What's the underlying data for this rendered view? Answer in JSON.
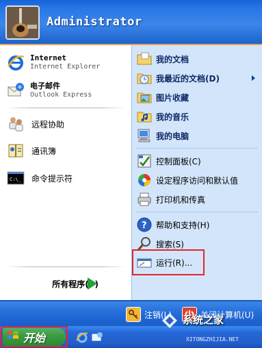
{
  "header": {
    "username": "Administrator",
    "avatar_icon": "guitar-avatar-icon"
  },
  "left": {
    "pinned": [
      {
        "title": "Internet",
        "subtitle": "Internet Explorer",
        "icon": "internet-explorer-icon"
      },
      {
        "title": "电子邮件",
        "subtitle": "Outlook Express",
        "icon": "outlook-express-icon"
      }
    ],
    "recent": [
      {
        "label": "远程协助",
        "icon": "remote-assistance-icon"
      },
      {
        "label": "通讯簿",
        "icon": "address-book-icon"
      },
      {
        "label": "命令提示符",
        "icon": "command-prompt-icon"
      }
    ],
    "all_programs": "所有程序(P)"
  },
  "right": {
    "items": [
      {
        "label": "我的文档",
        "bold": true,
        "icon": "my-documents-icon"
      },
      {
        "label": "我最近的文档(D)",
        "bold": true,
        "icon": "recent-documents-icon"
      },
      {
        "label": "图片收藏",
        "bold": true,
        "icon": "my-pictures-icon"
      },
      {
        "label": "我的音乐",
        "bold": true,
        "icon": "my-music-icon"
      },
      {
        "label": "我的电脑",
        "bold": true,
        "icon": "my-computer-icon"
      },
      {
        "label": "控制面板(C)",
        "bold": false,
        "icon": "control-panel-icon"
      },
      {
        "label": "设定程序访问和默认值",
        "bold": false,
        "icon": "program-defaults-icon"
      },
      {
        "label": "打印机和传真",
        "bold": false,
        "icon": "printer-icon"
      },
      {
        "label": "帮助和支持(H)",
        "bold": false,
        "icon": "help-icon"
      },
      {
        "label": "搜索(S)",
        "bold": false,
        "icon": "search-icon"
      },
      {
        "label": "运行(R)...",
        "bold": false,
        "icon": "run-icon"
      }
    ]
  },
  "bottom": {
    "logoff": "注销(L)",
    "shutdown": "关闭计算机(U)"
  },
  "taskbar": {
    "start_label": "开始"
  },
  "watermark": {
    "text": "系统之家",
    "url": "XITONGZHIJIA.NET"
  },
  "colors": {
    "header_blue": "#2b78e6",
    "right_pane": "#d3e5fa",
    "start_green": "#3c9a3f",
    "highlight_red": "#e0262b"
  }
}
